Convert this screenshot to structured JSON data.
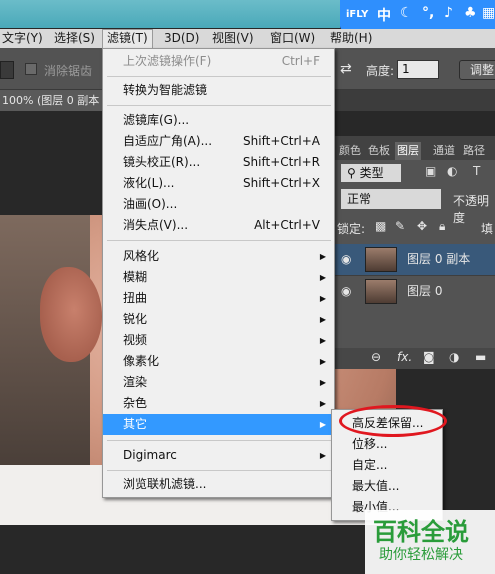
{
  "ime": {
    "brand": "iFLY",
    "mode": "中"
  },
  "menubar": {
    "items": [
      {
        "label": "文字(Y)"
      },
      {
        "label": "选择(S)"
      },
      {
        "label": "滤镜(T)"
      },
      {
        "label": "3D(D)"
      },
      {
        "label": "视图(V)"
      },
      {
        "label": "窗口(W)"
      },
      {
        "label": "帮助(H)"
      }
    ]
  },
  "options": {
    "antialias_label": "消除锯齿",
    "height_label": "高度:",
    "height_value": "1",
    "adjust_label": "调整"
  },
  "document": {
    "tab_label": "100% (图层 0 副本"
  },
  "filter_menu": {
    "items": [
      {
        "label": "上次滤镜操作(F)",
        "shortcut": "Ctrl+F",
        "disabled": true
      },
      {
        "label": "转换为智能滤镜"
      },
      {
        "label": "滤镜库(G)..."
      },
      {
        "label": "自适应广角(A)...",
        "shortcut": "Shift+Ctrl+A"
      },
      {
        "label": "镜头校正(R)...",
        "shortcut": "Shift+Ctrl+R"
      },
      {
        "label": "液化(L)...",
        "shortcut": "Shift+Ctrl+X"
      },
      {
        "label": "油画(O)..."
      },
      {
        "label": "消失点(V)...",
        "shortcut": "Alt+Ctrl+V"
      },
      {
        "label": "风格化",
        "submenu": true
      },
      {
        "label": "模糊",
        "submenu": true
      },
      {
        "label": "扭曲",
        "submenu": true
      },
      {
        "label": "锐化",
        "submenu": true
      },
      {
        "label": "视频",
        "submenu": true
      },
      {
        "label": "像素化",
        "submenu": true
      },
      {
        "label": "渲染",
        "submenu": true
      },
      {
        "label": "杂色",
        "submenu": true
      },
      {
        "label": "其它",
        "submenu": true,
        "highlighted": true
      },
      {
        "label": "Digimarc",
        "submenu": true
      },
      {
        "label": "浏览联机滤镜..."
      }
    ]
  },
  "other_submenu": {
    "items": [
      {
        "label": "高反差保留..."
      },
      {
        "label": "位移..."
      },
      {
        "label": "自定..."
      },
      {
        "label": "最大值..."
      },
      {
        "label": "最小值..."
      }
    ]
  },
  "layers_panel": {
    "tabs": [
      "颜色",
      "色板",
      "图层",
      "通道",
      "路径"
    ],
    "kind_label": "类型",
    "blend_mode": "正常",
    "opacity_label": "不透明度",
    "lock_label": "锁定:",
    "fill_label": "填",
    "layers": [
      {
        "name": "图层 0 副本"
      },
      {
        "name": "图层 0"
      }
    ]
  },
  "watermark": {
    "title": "百科全说",
    "subtitle": "助你轻松解决"
  },
  "colors": {
    "highlight": "#3399ff",
    "annotation": "#e0171f",
    "watermark": "#2a9c3a"
  }
}
